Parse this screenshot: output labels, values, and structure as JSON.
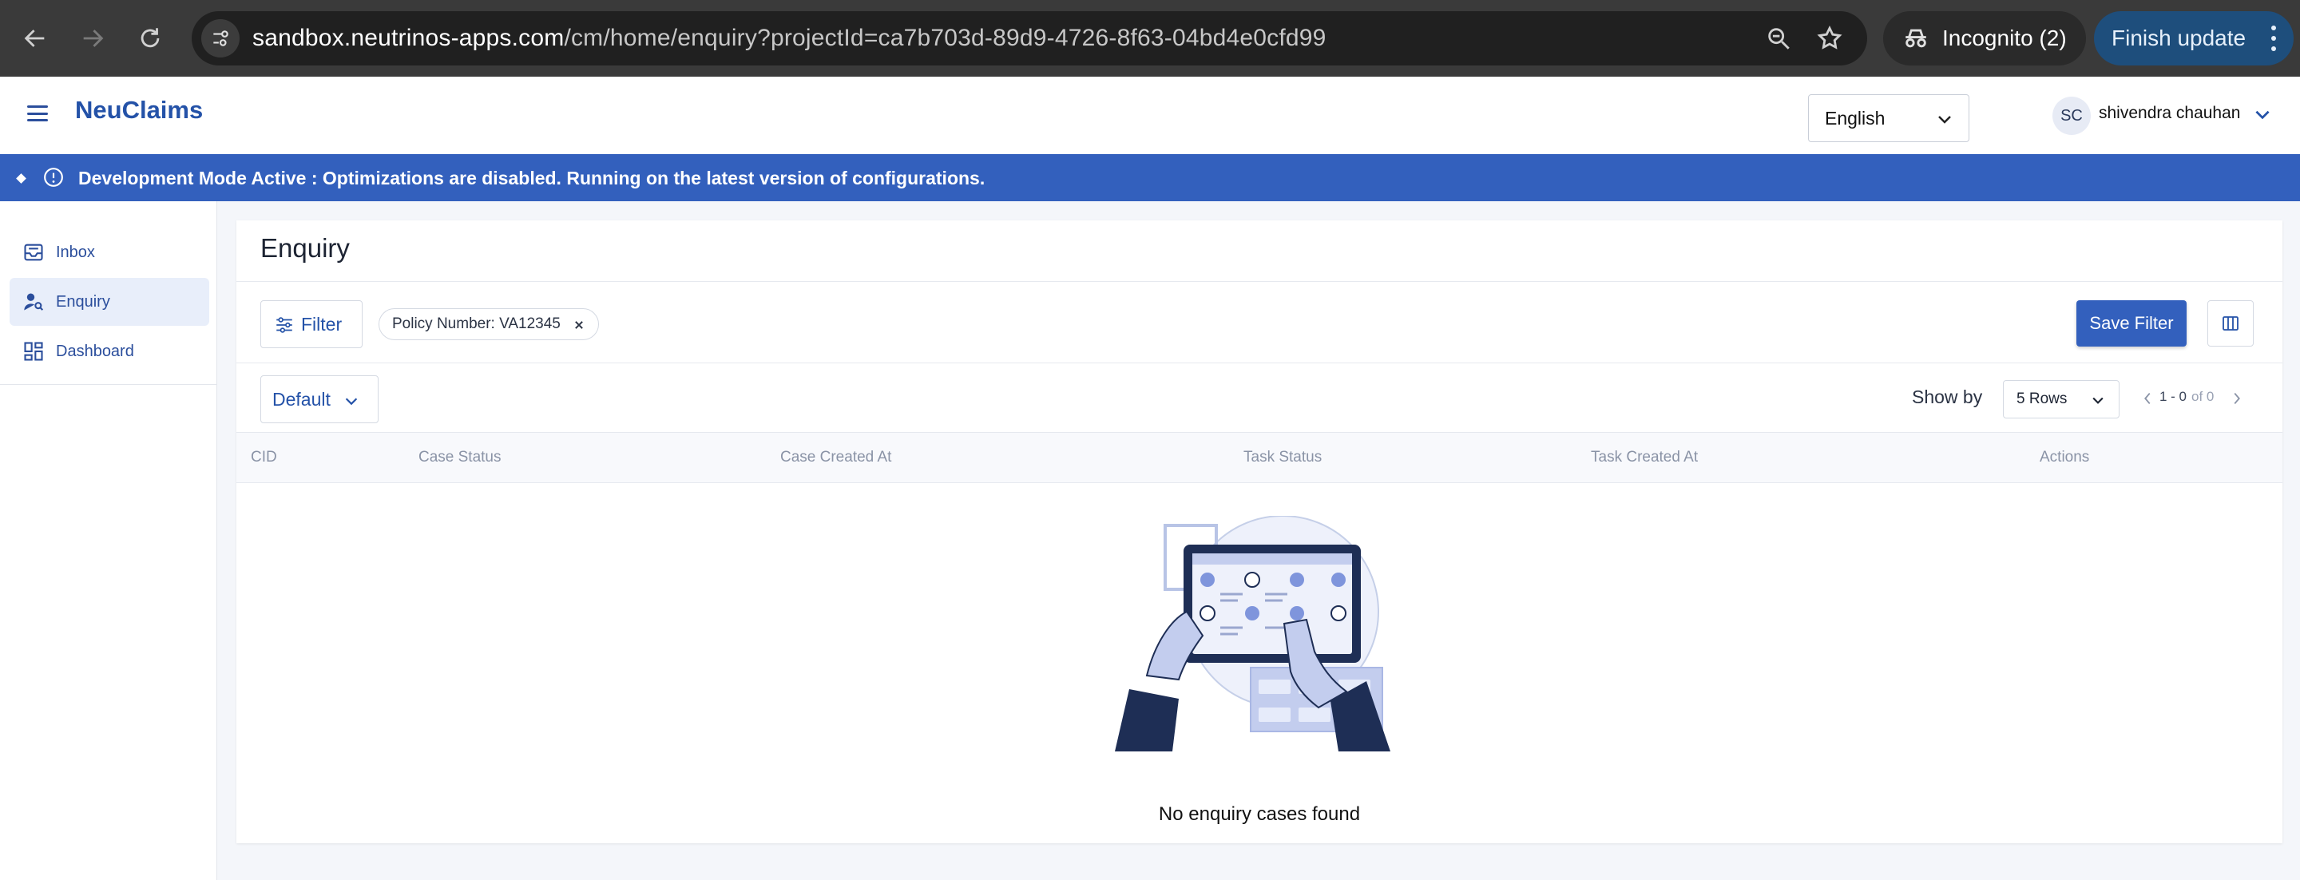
{
  "browser": {
    "url_host": "sandbox.neutrinos-apps.com",
    "url_path": "/cm/home/enquiry?projectId=ca7b703d-89d9-4726-8f63-04bd4e0cfd99",
    "incognito_label": "Incognito (2)",
    "finish_update_label": "Finish update",
    "icons": [
      "back-arrow-icon",
      "forward-arrow-icon",
      "reload-icon",
      "site-info-icon",
      "zoom-icon",
      "bookmark-star-icon",
      "incognito-icon",
      "more-vertical-icon"
    ]
  },
  "header": {
    "app_name": "NeuClaims",
    "language": "English",
    "user_initials": "SC",
    "user_name": "shivendra chauhan"
  },
  "banner": {
    "message": "Development Mode Active : Optimizations are disabled. Running on the latest version of configurations.",
    "color": "#3360bd"
  },
  "sidebar": {
    "items": [
      {
        "label": "Inbox",
        "icon": "inbox-icon",
        "active": false
      },
      {
        "label": "Enquiry",
        "icon": "user-search-icon",
        "active": true
      },
      {
        "label": "Dashboard",
        "icon": "dashboard-icon",
        "active": false
      }
    ]
  },
  "main": {
    "title": "Enquiry",
    "filter_label": "Filter",
    "chip_label": "Policy Number: VA12345",
    "save_filter_label": "Save Filter",
    "view_label": "Default",
    "show_by_label": "Show by",
    "rows_value": "5 Rows",
    "pager_range": "1 - 0",
    "pager_of": "of 0",
    "columns": [
      "CID",
      "Case Status",
      "Case Created At",
      "Task Status",
      "Task Created At",
      "Actions"
    ],
    "empty_message": "No enquiry cases found"
  },
  "colors": {
    "primary": "#3360bd",
    "brand_text": "#2452a8",
    "sidebar_active_bg": "#e8eefa"
  }
}
